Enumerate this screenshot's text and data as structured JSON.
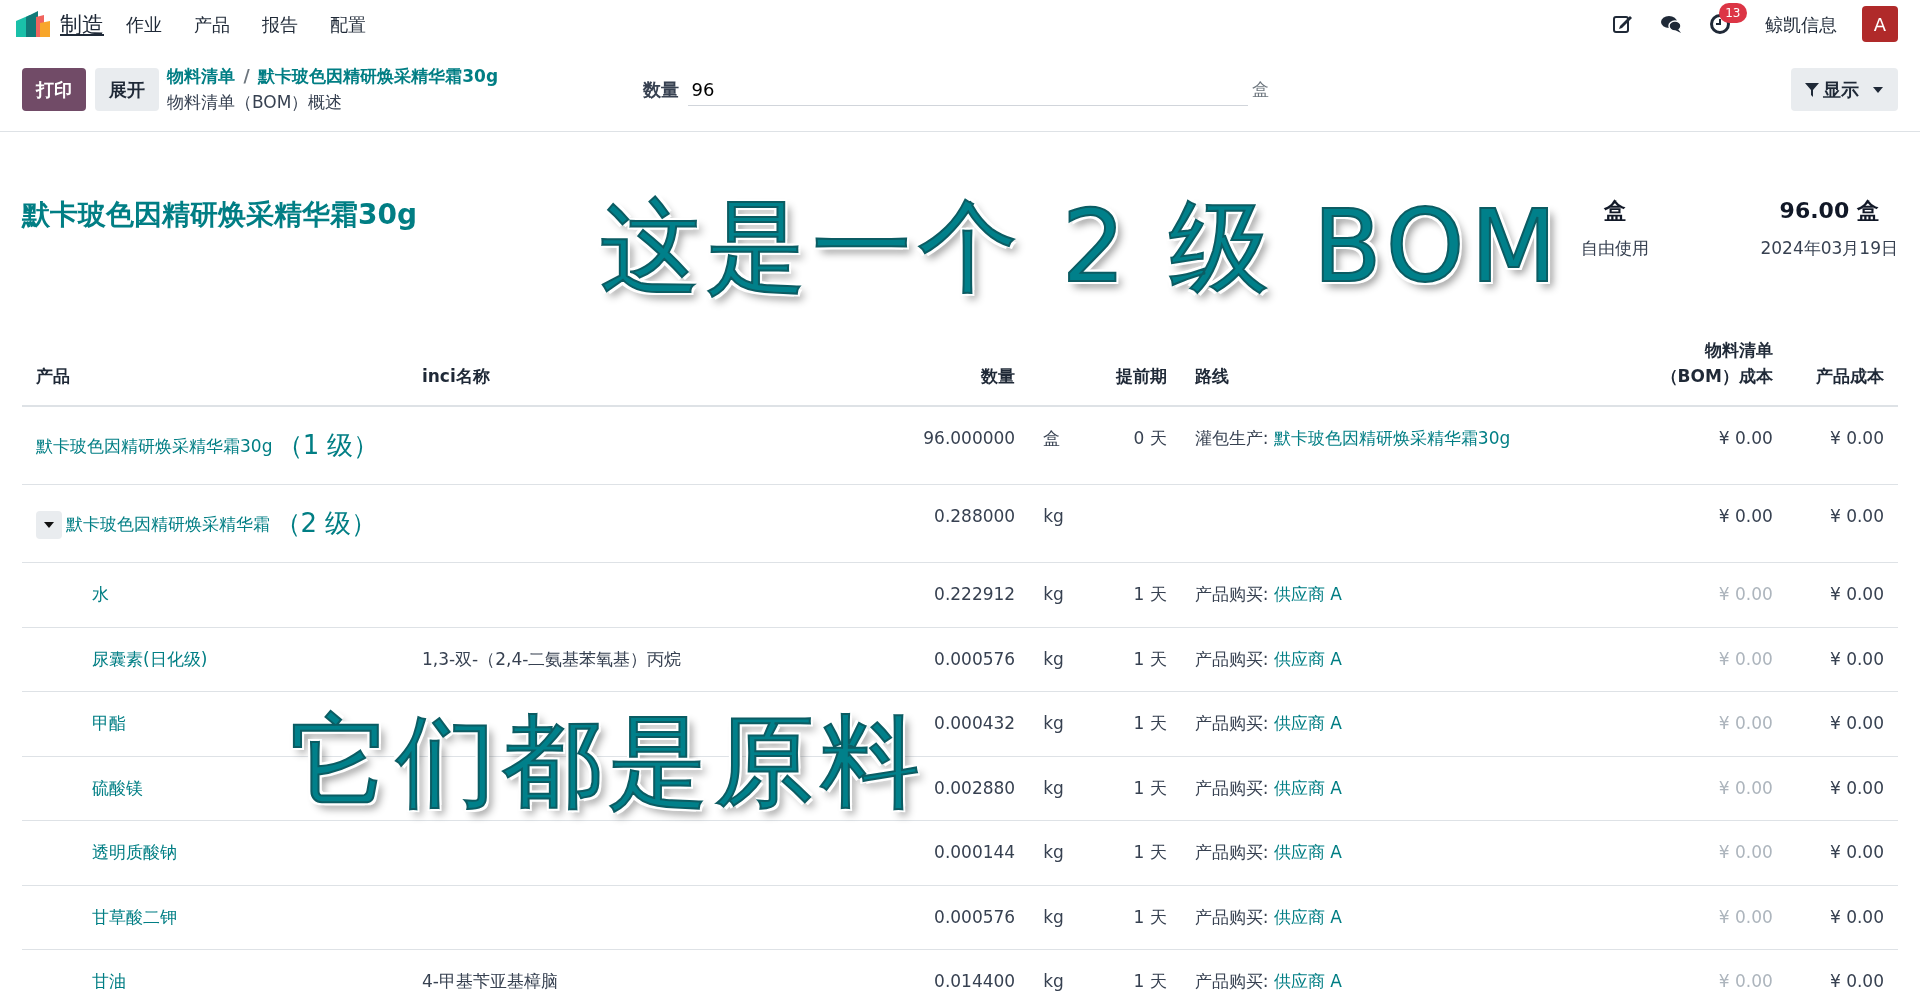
{
  "navbar": {
    "app_name": "制造",
    "menu": [
      "作业",
      "产品",
      "报告",
      "配置"
    ],
    "activity_count": "13",
    "company": "鲸凯信息",
    "avatar_letter": "A"
  },
  "control_panel": {
    "buttons": [
      {
        "label": "打印",
        "kind": "primary"
      },
      {
        "label": "展开",
        "kind": "secondary"
      }
    ],
    "breadcrumb": [
      "物料清单",
      "默卡玻色因精研焕采精华霜30g"
    ],
    "breadcrumb_separator": "/",
    "subtitle": "物料清单（BOM）概述",
    "quantity": {
      "label": "数量",
      "value": "96",
      "unit": "盒"
    },
    "display_button": "显示"
  },
  "report": {
    "title": "默卡玻色因精研焕采精华霜30g",
    "summary": [
      {
        "value": "盒",
        "label": "自由使用"
      },
      {
        "value": "96.00 盒",
        "label": "2024年03月19日"
      }
    ],
    "columns": [
      "产品",
      "inci名称",
      "数量",
      "",
      "提前期",
      "路线",
      "物料清单（BOM）成本",
      "产品成本"
    ],
    "lines": [
      {
        "product": "默卡玻色因精研焕采精华霜30g",
        "annotation": "（1 级）",
        "quantity": "96.000000",
        "unit": "盒",
        "lead": "0 天",
        "route_label": "灌包生产: ",
        "route_link": "默卡玻色因精研焕采精华霜30g",
        "bom_cost": "¥ 0.00",
        "product_cost": "¥ 0.00",
        "children": [
          {
            "product": "默卡玻色因精研焕采精华霜",
            "annotation": "（2 级）",
            "expanded": true,
            "quantity": "0.288000",
            "unit": "kg",
            "bom_cost": "¥ 0.00",
            "product_cost": "¥ 0.00",
            "children": [
              {
                "product": "水",
                "quantity": "0.222912",
                "unit": "kg",
                "lead": "1 天",
                "route_label": "产品购买: ",
                "route_link": "供应商 A",
                "bom_cost": "¥ 0.00",
                "product_cost": "¥ 0.00"
              },
              {
                "product": "尿囊素(日化级)",
                "inci": "1,3-双-（2,4-二氨基苯氧基）丙烷",
                "quantity": "0.000576",
                "unit": "kg",
                "lead": "1 天",
                "route_label": "产品购买: ",
                "route_link": "供应商 A",
                "bom_cost": "¥ 0.00",
                "product_cost": "¥ 0.00"
              },
              {
                "product": "甲酯",
                "quantity": "0.000432",
                "unit": "kg",
                "lead": "1 天",
                "route_label": "产品购买: ",
                "route_link": "供应商 A",
                "bom_cost": "¥ 0.00",
                "product_cost": "¥ 0.00"
              },
              {
                "product": "硫酸镁",
                "quantity": "0.002880",
                "unit": "kg",
                "lead": "1 天",
                "route_label": "产品购买: ",
                "route_link": "供应商 A",
                "bom_cost": "¥ 0.00",
                "product_cost": "¥ 0.00"
              },
              {
                "product": "透明质酸钠",
                "quantity": "0.000144",
                "unit": "kg",
                "lead": "1 天",
                "route_label": "产品购买: ",
                "route_link": "供应商 A",
                "bom_cost": "¥ 0.00",
                "product_cost": "¥ 0.00"
              },
              {
                "product": "甘草酸二钾",
                "quantity": "0.000576",
                "unit": "kg",
                "lead": "1 天",
                "route_label": "产品购买: ",
                "route_link": "供应商 A",
                "bom_cost": "¥ 0.00",
                "product_cost": "¥ 0.00"
              },
              {
                "product": "甘油",
                "inci": "4-甲基苄亚基樟脑",
                "quantity": "0.014400",
                "unit": "kg",
                "lead": "1 天",
                "route_label": "产品购买: ",
                "route_link": "供应商 A",
                "bom_cost": "¥ 0.00",
                "product_cost": "¥ 0.00"
              }
            ]
          }
        ]
      }
    ]
  },
  "annotations": [
    {
      "text": "这是一个 2 级 BOM",
      "kind": "headline"
    },
    {
      "text": "它们都是原料",
      "kind": "note"
    }
  ]
}
